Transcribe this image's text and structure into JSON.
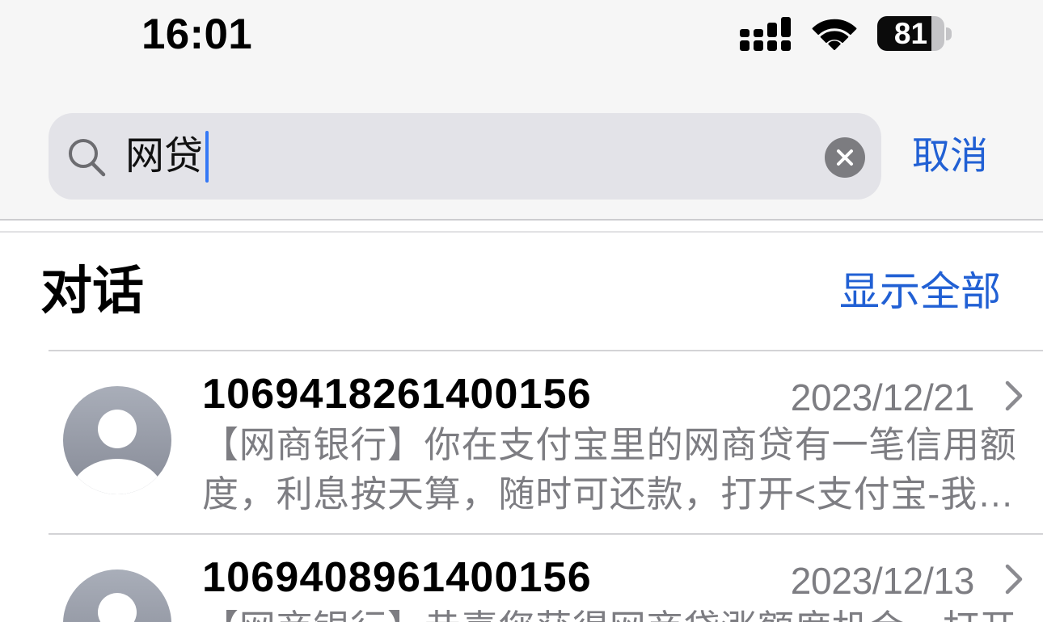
{
  "status_bar": {
    "time": "16:01",
    "battery_percent": 81,
    "signal_icon": "cellular-signal-icon",
    "wifi_icon": "wifi-icon",
    "battery_icon": "battery-icon"
  },
  "search": {
    "query": "网贷",
    "search_icon": "magnifying-glass-icon",
    "clear_icon": "clear-text-icon",
    "cancel_label": "取消"
  },
  "conversations_section": {
    "title": "对话",
    "show_all_label": "显示全部"
  },
  "conversations": [
    {
      "sender": "1069418261400156",
      "date": "2023/12/21",
      "avatar_icon": "person-placeholder-icon",
      "chevron_icon": "chevron-right-icon",
      "preview_lines": [
        "【网商银行】你在支付宝里的网商贷有一笔信用额",
        "度，利息按天算，随时可还款，打开<支付宝-我…"
      ]
    },
    {
      "sender": "1069408961400156",
      "date": "2023/12/13",
      "avatar_icon": "person-placeholder-icon",
      "chevron_icon": "chevron-right-icon",
      "preview_lines": [
        "【网商银行】恭喜您获得网商贷涨额度机会，打开"
      ]
    }
  ],
  "colors": {
    "accent": "#2160d4",
    "caret": "#3478f6",
    "secondary_text": "#7d7d82",
    "search_field": "#e3e3e8",
    "avatar_top": "#a9aeb9",
    "avatar_bottom": "#868a96",
    "header_background": "#f6f6f6",
    "separator": "#d3d3d6",
    "chevron": "#8b8b90"
  }
}
